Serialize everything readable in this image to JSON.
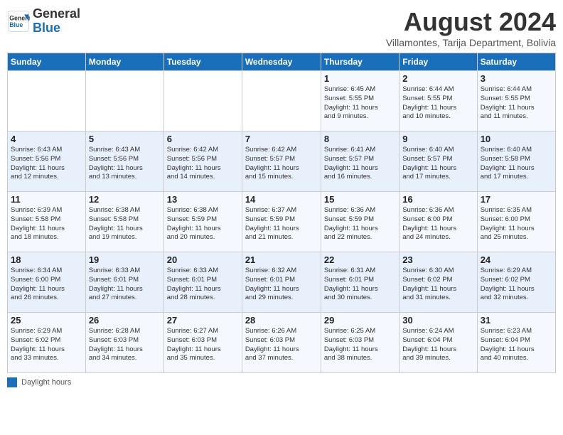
{
  "header": {
    "logo_general": "General",
    "logo_blue": "Blue",
    "month_year": "August 2024",
    "location": "Villamontes, Tarija Department, Bolivia"
  },
  "weekdays": [
    "Sunday",
    "Monday",
    "Tuesday",
    "Wednesday",
    "Thursday",
    "Friday",
    "Saturday"
  ],
  "legend": {
    "label": "Daylight hours"
  },
  "weeks": [
    [
      {
        "day": "",
        "info": ""
      },
      {
        "day": "",
        "info": ""
      },
      {
        "day": "",
        "info": ""
      },
      {
        "day": "",
        "info": ""
      },
      {
        "day": "1",
        "info": "Sunrise: 6:45 AM\nSunset: 5:55 PM\nDaylight: 11 hours\nand 9 minutes."
      },
      {
        "day": "2",
        "info": "Sunrise: 6:44 AM\nSunset: 5:55 PM\nDaylight: 11 hours\nand 10 minutes."
      },
      {
        "day": "3",
        "info": "Sunrise: 6:44 AM\nSunset: 5:55 PM\nDaylight: 11 hours\nand 11 minutes."
      }
    ],
    [
      {
        "day": "4",
        "info": "Sunrise: 6:43 AM\nSunset: 5:56 PM\nDaylight: 11 hours\nand 12 minutes."
      },
      {
        "day": "5",
        "info": "Sunrise: 6:43 AM\nSunset: 5:56 PM\nDaylight: 11 hours\nand 13 minutes."
      },
      {
        "day": "6",
        "info": "Sunrise: 6:42 AM\nSunset: 5:56 PM\nDaylight: 11 hours\nand 14 minutes."
      },
      {
        "day": "7",
        "info": "Sunrise: 6:42 AM\nSunset: 5:57 PM\nDaylight: 11 hours\nand 15 minutes."
      },
      {
        "day": "8",
        "info": "Sunrise: 6:41 AM\nSunset: 5:57 PM\nDaylight: 11 hours\nand 16 minutes."
      },
      {
        "day": "9",
        "info": "Sunrise: 6:40 AM\nSunset: 5:57 PM\nDaylight: 11 hours\nand 17 minutes."
      },
      {
        "day": "10",
        "info": "Sunrise: 6:40 AM\nSunset: 5:58 PM\nDaylight: 11 hours\nand 17 minutes."
      }
    ],
    [
      {
        "day": "11",
        "info": "Sunrise: 6:39 AM\nSunset: 5:58 PM\nDaylight: 11 hours\nand 18 minutes."
      },
      {
        "day": "12",
        "info": "Sunrise: 6:38 AM\nSunset: 5:58 PM\nDaylight: 11 hours\nand 19 minutes."
      },
      {
        "day": "13",
        "info": "Sunrise: 6:38 AM\nSunset: 5:59 PM\nDaylight: 11 hours\nand 20 minutes."
      },
      {
        "day": "14",
        "info": "Sunrise: 6:37 AM\nSunset: 5:59 PM\nDaylight: 11 hours\nand 21 minutes."
      },
      {
        "day": "15",
        "info": "Sunrise: 6:36 AM\nSunset: 5:59 PM\nDaylight: 11 hours\nand 22 minutes."
      },
      {
        "day": "16",
        "info": "Sunrise: 6:36 AM\nSunset: 6:00 PM\nDaylight: 11 hours\nand 24 minutes."
      },
      {
        "day": "17",
        "info": "Sunrise: 6:35 AM\nSunset: 6:00 PM\nDaylight: 11 hours\nand 25 minutes."
      }
    ],
    [
      {
        "day": "18",
        "info": "Sunrise: 6:34 AM\nSunset: 6:00 PM\nDaylight: 11 hours\nand 26 minutes."
      },
      {
        "day": "19",
        "info": "Sunrise: 6:33 AM\nSunset: 6:01 PM\nDaylight: 11 hours\nand 27 minutes."
      },
      {
        "day": "20",
        "info": "Sunrise: 6:33 AM\nSunset: 6:01 PM\nDaylight: 11 hours\nand 28 minutes."
      },
      {
        "day": "21",
        "info": "Sunrise: 6:32 AM\nSunset: 6:01 PM\nDaylight: 11 hours\nand 29 minutes."
      },
      {
        "day": "22",
        "info": "Sunrise: 6:31 AM\nSunset: 6:01 PM\nDaylight: 11 hours\nand 30 minutes."
      },
      {
        "day": "23",
        "info": "Sunrise: 6:30 AM\nSunset: 6:02 PM\nDaylight: 11 hours\nand 31 minutes."
      },
      {
        "day": "24",
        "info": "Sunrise: 6:29 AM\nSunset: 6:02 PM\nDaylight: 11 hours\nand 32 minutes."
      }
    ],
    [
      {
        "day": "25",
        "info": "Sunrise: 6:29 AM\nSunset: 6:02 PM\nDaylight: 11 hours\nand 33 minutes."
      },
      {
        "day": "26",
        "info": "Sunrise: 6:28 AM\nSunset: 6:03 PM\nDaylight: 11 hours\nand 34 minutes."
      },
      {
        "day": "27",
        "info": "Sunrise: 6:27 AM\nSunset: 6:03 PM\nDaylight: 11 hours\nand 35 minutes."
      },
      {
        "day": "28",
        "info": "Sunrise: 6:26 AM\nSunset: 6:03 PM\nDaylight: 11 hours\nand 37 minutes."
      },
      {
        "day": "29",
        "info": "Sunrise: 6:25 AM\nSunset: 6:03 PM\nDaylight: 11 hours\nand 38 minutes."
      },
      {
        "day": "30",
        "info": "Sunrise: 6:24 AM\nSunset: 6:04 PM\nDaylight: 11 hours\nand 39 minutes."
      },
      {
        "day": "31",
        "info": "Sunrise: 6:23 AM\nSunset: 6:04 PM\nDaylight: 11 hours\nand 40 minutes."
      }
    ]
  ]
}
